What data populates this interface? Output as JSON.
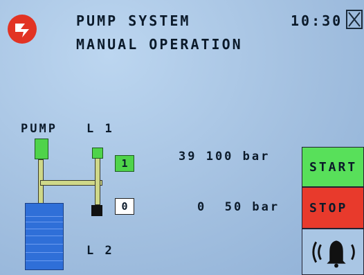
{
  "header": {
    "title": "PUMP SYSTEM",
    "subtitle": "MANUAL OPERATION",
    "time": "10:30",
    "close_icon": "close-icon",
    "logo_icon": "brand-logo-icon"
  },
  "diagram": {
    "pump_label": "PUMP",
    "l1_label": "L 1",
    "l2_label": "L 2",
    "l1_state": "1",
    "l2_state": "0",
    "l1_reading": "39 100 bar",
    "l2_reading": "0  50 bar",
    "colors": {
      "active": "#4fd34a",
      "inactive": "#111111",
      "pipe": "#cfd889",
      "tank": "#2f6fd8"
    }
  },
  "controls": {
    "start_label": "START",
    "stop_label": "STOP",
    "alarm_icon": "alarm-bell-icon",
    "colors": {
      "start": "#58e05a",
      "stop": "#e83a2c",
      "alarm": "#a9c6e4"
    }
  }
}
